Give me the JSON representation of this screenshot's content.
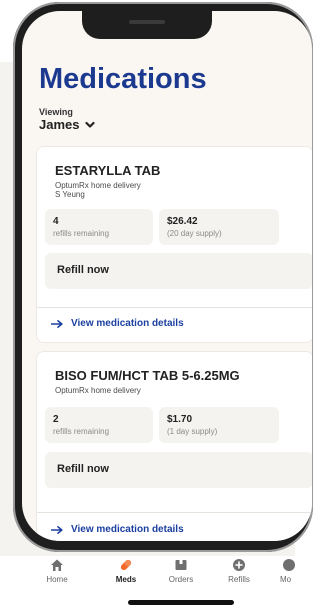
{
  "page": {
    "title": "Medications",
    "viewing_label": "Viewing",
    "viewer_name": "James"
  },
  "medications": [
    {
      "name": "ESTARYLLA TAB",
      "source": "OptumRx home delivery",
      "prescriber": "S Yeung",
      "refills_count": "4",
      "refills_label": "refills remaining",
      "price": "$26.42",
      "supply": "(20 day supply)",
      "refill_button": "Refill now",
      "details_link": "View medication details"
    },
    {
      "name": "BISO FUM/HCT TAB 5-6.25MG",
      "source": "OptumRx home delivery",
      "refills_count": "2",
      "refills_label": "refills remaining",
      "price": "$1.70",
      "supply": "(1 day supply)",
      "refill_button": "Refill now",
      "details_link": "View medication details"
    }
  ],
  "nav": {
    "items": [
      {
        "label": "Home",
        "icon": "home-icon"
      },
      {
        "label": "Meds",
        "icon": "pill-icon",
        "active": true
      },
      {
        "label": "Orders",
        "icon": "box-icon"
      },
      {
        "label": "Refills",
        "icon": "plus-circle-icon"
      },
      {
        "label": "Mo",
        "icon": "more-icon"
      }
    ]
  },
  "colors": {
    "brand_blue": "#1b3a8f",
    "link_blue": "#1b3fa0",
    "active_orange": "#f26b2b",
    "nav_icon_gray": "#6f6f6f"
  }
}
